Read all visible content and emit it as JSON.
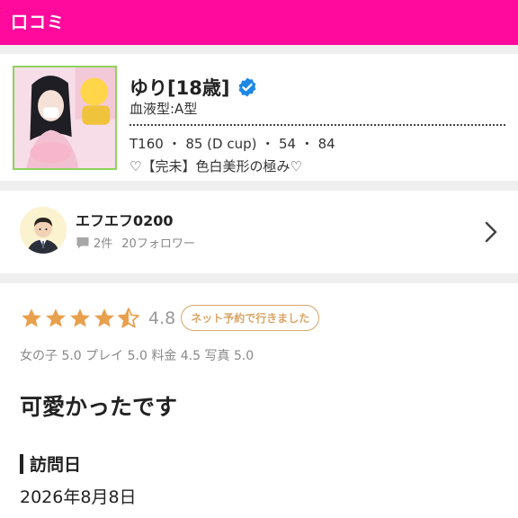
{
  "header": {
    "title": "口コミ"
  },
  "colors": {
    "header_bg": "#ff0a9c",
    "star": "#e9a04c",
    "badge": "#d9a567",
    "verified": "#1e88e5"
  },
  "profile": {
    "name": "ゆり[18歳]",
    "verified_icon": "verified-check-icon",
    "blood_type": "血液型:A型",
    "stats": "T160 ・ 85 (D cup) ・ 54 ・ 84",
    "catchphrase": "♡【完未】色白美形の極み♡"
  },
  "reviewer": {
    "name": "エフエフ0200",
    "review_count": "2件",
    "followers": "20フォロワー",
    "avatar_icon": "user-avatar-icon"
  },
  "review": {
    "stars": 4.5,
    "rating": "4.8",
    "badge": "ネット予約で行きました",
    "scores": "女の子 5.0 プレイ 5.0 料金 4.5 写真 5.0",
    "title": "可愛かったです",
    "visit_label": "訪問日",
    "visit_date": "2026年8月8日"
  }
}
